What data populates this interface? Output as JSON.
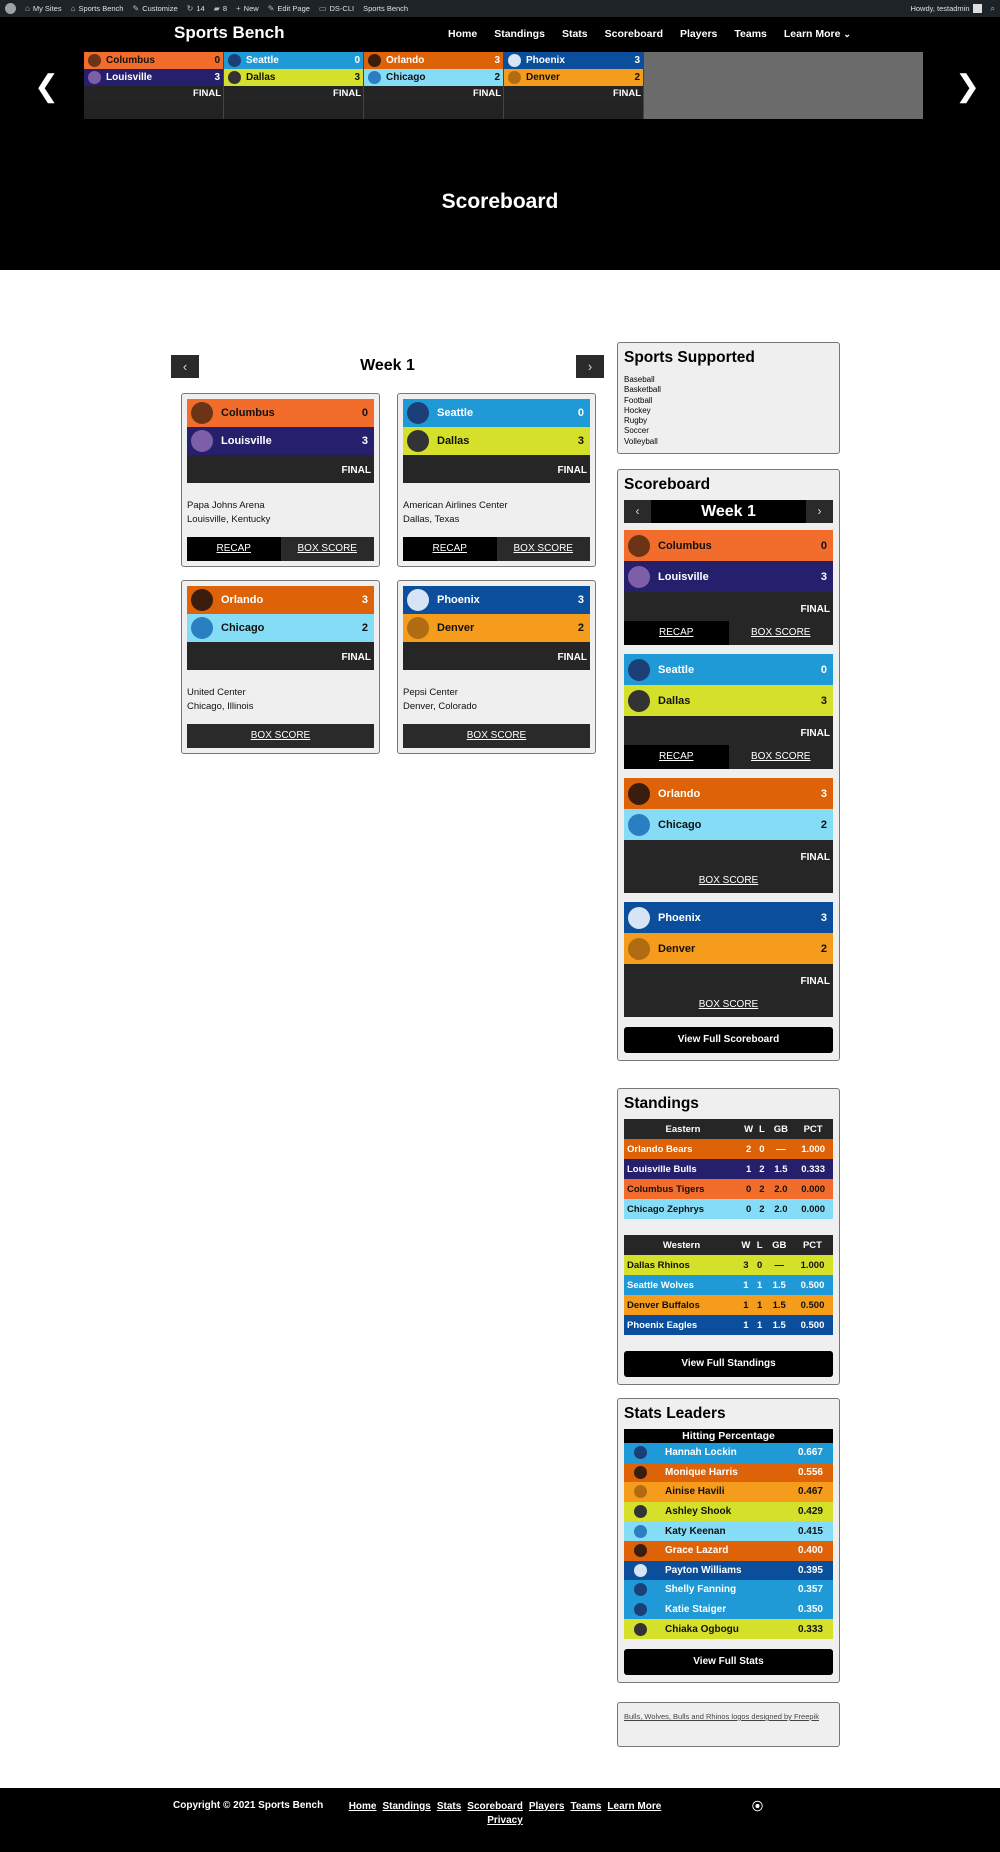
{
  "adminbar": {
    "items": [
      "My Sites",
      "Sports Bench",
      "Customize",
      "14",
      "8",
      "New",
      "Edit Page",
      "DS-CLI",
      "Sports Bench"
    ],
    "greeting": "Howdy, testadmin"
  },
  "site": {
    "title": "Sports Bench"
  },
  "nav": [
    "Home",
    "Standings",
    "Stats",
    "Scoreboard",
    "Players",
    "Teams",
    "Learn More"
  ],
  "nav_learn_more_caret": "⌄",
  "colors": {
    "columbus": "#f26d2b",
    "louisville": "#261f6c",
    "seattle": "#1f9ad6",
    "dallas": "#d4e02a",
    "orlando": "#dd6208",
    "chicago": "#85dcf7",
    "phoenix": "#0b4f9c",
    "denver": "#f59c1c"
  },
  "ticker": [
    {
      "away": {
        "name": "Columbus",
        "score": "0",
        "team": "columbus"
      },
      "home": {
        "name": "Louisville",
        "score": "3",
        "team": "louisville"
      },
      "status": "FINAL"
    },
    {
      "away": {
        "name": "Seattle",
        "score": "0",
        "team": "seattle"
      },
      "home": {
        "name": "Dallas",
        "score": "3",
        "team": "dallas"
      },
      "status": "FINAL"
    },
    {
      "away": {
        "name": "Orlando",
        "score": "3",
        "team": "orlando"
      },
      "home": {
        "name": "Chicago",
        "score": "2",
        "team": "chicago"
      },
      "status": "FINAL"
    },
    {
      "away": {
        "name": "Phoenix",
        "score": "3",
        "team": "phoenix"
      },
      "home": {
        "name": "Denver",
        "score": "2",
        "team": "denver"
      },
      "status": "FINAL"
    }
  ],
  "page_title": "Scoreboard",
  "scoreboard": {
    "week": "Week 1",
    "games": [
      {
        "away": {
          "name": "Columbus",
          "score": "0"
        },
        "home": {
          "name": "Louisville",
          "score": "3"
        },
        "status": "FINAL",
        "venue": "Papa Johns Arena",
        "location": "Louisville, Kentucky",
        "recap": "RECAP",
        "box": "BOX SCORE"
      },
      {
        "away": {
          "name": "Seattle",
          "score": "0"
        },
        "home": {
          "name": "Dallas",
          "score": "3"
        },
        "status": "FINAL",
        "venue": "American Airlines Center",
        "location": "Dallas, Texas",
        "recap": "RECAP",
        "box": "BOX SCORE"
      },
      {
        "away": {
          "name": "Orlando",
          "score": "3"
        },
        "home": {
          "name": "Chicago",
          "score": "2"
        },
        "status": "FINAL",
        "venue": "United Center",
        "location": "Chicago, Illinois",
        "box": "BOX SCORE"
      },
      {
        "away": {
          "name": "Phoenix",
          "score": "3"
        },
        "home": {
          "name": "Denver",
          "score": "2"
        },
        "status": "FINAL",
        "venue": "Pepsi Center",
        "location": "Denver, Colorado",
        "box": "BOX SCORE"
      }
    ]
  },
  "sidebar": {
    "sports": {
      "title": "Sports Supported",
      "items": [
        "Baseball",
        "Basketball",
        "Football",
        "Hockey",
        "Rugby",
        "Soccer",
        "Volleyball"
      ]
    },
    "scoreboard": {
      "title": "Scoreboard",
      "week": "Week 1",
      "button": "View Full Scoreboard"
    },
    "standings": {
      "title": "Standings",
      "columns": [
        "W",
        "L",
        "GB",
        "PCT"
      ],
      "divisions": [
        {
          "name": "Eastern",
          "rows": [
            {
              "team": "Orlando Bears",
              "w": "2",
              "l": "0",
              "gb": "—",
              "pct": "1.000"
            },
            {
              "team": "Louisville Bulls",
              "w": "1",
              "l": "2",
              "gb": "1.5",
              "pct": "0.333"
            },
            {
              "team": "Columbus Tigers",
              "w": "0",
              "l": "2",
              "gb": "2.0",
              "pct": "0.000"
            },
            {
              "team": "Chicago Zephrys",
              "w": "0",
              "l": "2",
              "gb": "2.0",
              "pct": "0.000"
            }
          ]
        },
        {
          "name": "Western",
          "rows": [
            {
              "team": "Dallas Rhinos",
              "w": "3",
              "l": "0",
              "gb": "—",
              "pct": "1.000"
            },
            {
              "team": "Seattle Wolves",
              "w": "1",
              "l": "1",
              "gb": "1.5",
              "pct": "0.500"
            },
            {
              "team": "Denver Buffalos",
              "w": "1",
              "l": "1",
              "gb": "1.5",
              "pct": "0.500"
            },
            {
              "team": "Phoenix Eagles",
              "w": "1",
              "l": "1",
              "gb": "1.5",
              "pct": "0.500"
            }
          ]
        }
      ],
      "button": "View Full Standings"
    },
    "leaders": {
      "title": "Stats Leaders",
      "stat": "Hitting Percentage",
      "rows": [
        {
          "name": "Hannah Lockin",
          "value": "0.667"
        },
        {
          "name": "Monique Harris",
          "value": "0.556"
        },
        {
          "name": "Ainise Havili",
          "value": "0.467"
        },
        {
          "name": "Ashley Shook",
          "value": "0.429"
        },
        {
          "name": "Katy Keenan",
          "value": "0.415"
        },
        {
          "name": "Grace Lazard",
          "value": "0.400"
        },
        {
          "name": "Payton Williams",
          "value": "0.395"
        },
        {
          "name": "Shelly Fanning",
          "value": "0.357"
        },
        {
          "name": "Katie Staiger",
          "value": "0.350"
        },
        {
          "name": "Chiaka Ogbogu",
          "value": "0.333"
        }
      ],
      "button": "View Full Stats"
    },
    "credit": "Bulls, Wolves, Bulls and Rhinos logos designed by Freepik"
  },
  "footer": {
    "copyright": "Copyright © 2021 Sports Bench",
    "links": [
      "Home",
      "Standings",
      "Stats",
      "Scoreboard",
      "Players",
      "Teams",
      "Learn More",
      "Privacy"
    ]
  }
}
